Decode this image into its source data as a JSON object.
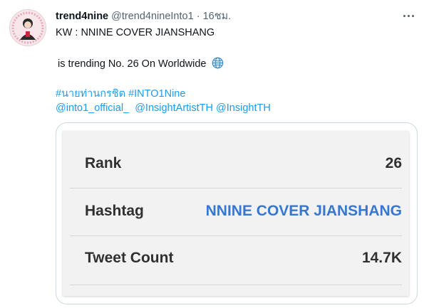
{
  "tweet": {
    "display_name": "trend4nine",
    "handle": "@trend4nineInto1",
    "separator": "·",
    "time": "16ชม.",
    "line_kw": "KW : NNINE COVER JIANSHANG",
    "line_trending": "is trending  No. 26 On Worldwide",
    "hashtags": [
      "#นายท่านกรชิต",
      "#INTO1Nine"
    ],
    "mentions": [
      "@into1_official_",
      "@InsightArtistTH",
      "@InsightTH"
    ],
    "icons": {
      "globe": "globe-icon",
      "more": "more-options-icon"
    }
  },
  "card": {
    "rows": [
      {
        "label": "Rank",
        "value": "26"
      },
      {
        "label": "Hashtag",
        "value": "NNINE COVER JIANSHANG"
      },
      {
        "label": "Tweet Count",
        "value": "14.7K"
      }
    ],
    "colors": {
      "accent": "#3677d1",
      "text": "#303030",
      "panel": "#f2f2f2"
    }
  },
  "colors": {
    "link": "#1d9bf0",
    "muted": "#536471"
  }
}
